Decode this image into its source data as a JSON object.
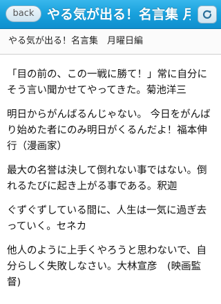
{
  "header": {
    "back_label": "back",
    "title": "やる気が出る！名言集 月曜日編"
  },
  "subtitle": "やる気が出る！名言集　月曜日編",
  "quotes": [
    "「目の前の、この一戦に勝て！」常に自分にそう言い聞かせてやってきた。菊池洋三",
    "明日からがんばるんじゃない。 今日をがんばり始めた者にのみ明日がくるんだよ！福本伸行（漫画家）",
    "最大の名誉は決して倒れない事ではない。倒れるたびに起き上がる事である。釈迦",
    "ぐずぐずしている間に、人生は一気に過ぎ去っていく。セネカ",
    "他人のように上手くやろうと思わないで、自分らしく失敗しなさい。大林宣彦　(映画監督)"
  ]
}
